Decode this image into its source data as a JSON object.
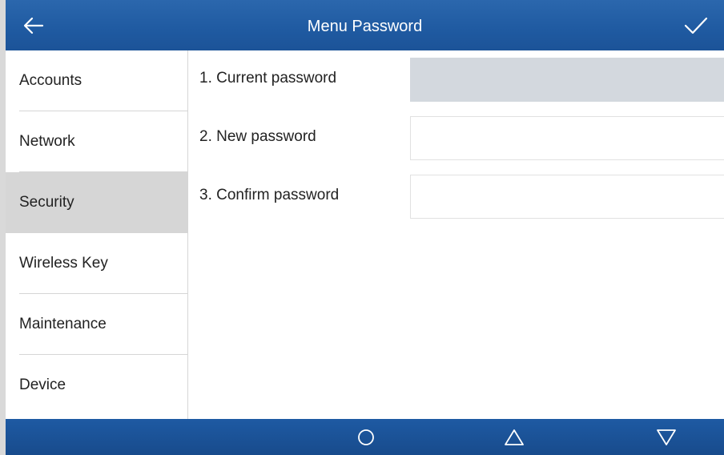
{
  "header": {
    "title": "Menu Password",
    "back_icon": "arrow-left-icon",
    "confirm_icon": "checkmark-icon"
  },
  "sidebar": {
    "items": [
      {
        "label": "Accounts",
        "active": false
      },
      {
        "label": "Network",
        "active": false
      },
      {
        "label": "Security",
        "active": true
      },
      {
        "label": "Wireless Key",
        "active": false
      },
      {
        "label": "Maintenance",
        "active": false
      },
      {
        "label": "Device",
        "active": false
      }
    ]
  },
  "form": {
    "fields": [
      {
        "label": "1. Current password",
        "value": "",
        "disabled": true
      },
      {
        "label": "2. New password",
        "value": "",
        "disabled": false
      },
      {
        "label": "3. Confirm password",
        "value": "",
        "disabled": false
      }
    ]
  },
  "navbar": {
    "home_icon": "circle-icon",
    "up_icon": "triangle-up-icon",
    "down_icon": "triangle-down-icon"
  },
  "colors": {
    "header_blue": "#1f5aa1",
    "active_item_bg": "#d6d6d6",
    "disabled_input_bg": "#d3d8de"
  }
}
